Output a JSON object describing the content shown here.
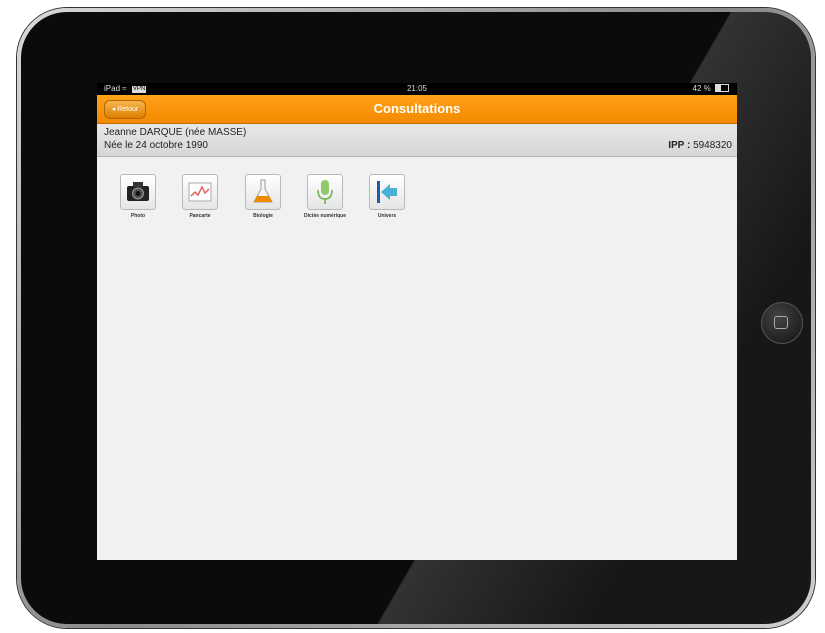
{
  "status_bar": {
    "device": "iPad",
    "vpn": "VPN",
    "time": "21:05",
    "battery": "42 %",
    "battery_level": 0.42
  },
  "navbar": {
    "back_label": "◂ Retour",
    "title": "Consultations"
  },
  "patient": {
    "name": "Jeanne DARQUE (née MASSE)",
    "dob": "Née le 24 octobre 1990",
    "ipp_label": "IPP :",
    "ipp_value": "5948320"
  },
  "tiles": [
    {
      "label": "Photo",
      "icon": "camera-icon"
    },
    {
      "label": "Pancarte",
      "icon": "chart-icon"
    },
    {
      "label": "Biologie",
      "icon": "flask-icon"
    },
    {
      "label": "Dictée numérique",
      "icon": "microphone-icon"
    },
    {
      "label": "Univers",
      "icon": "back-arrow-icon"
    }
  ]
}
